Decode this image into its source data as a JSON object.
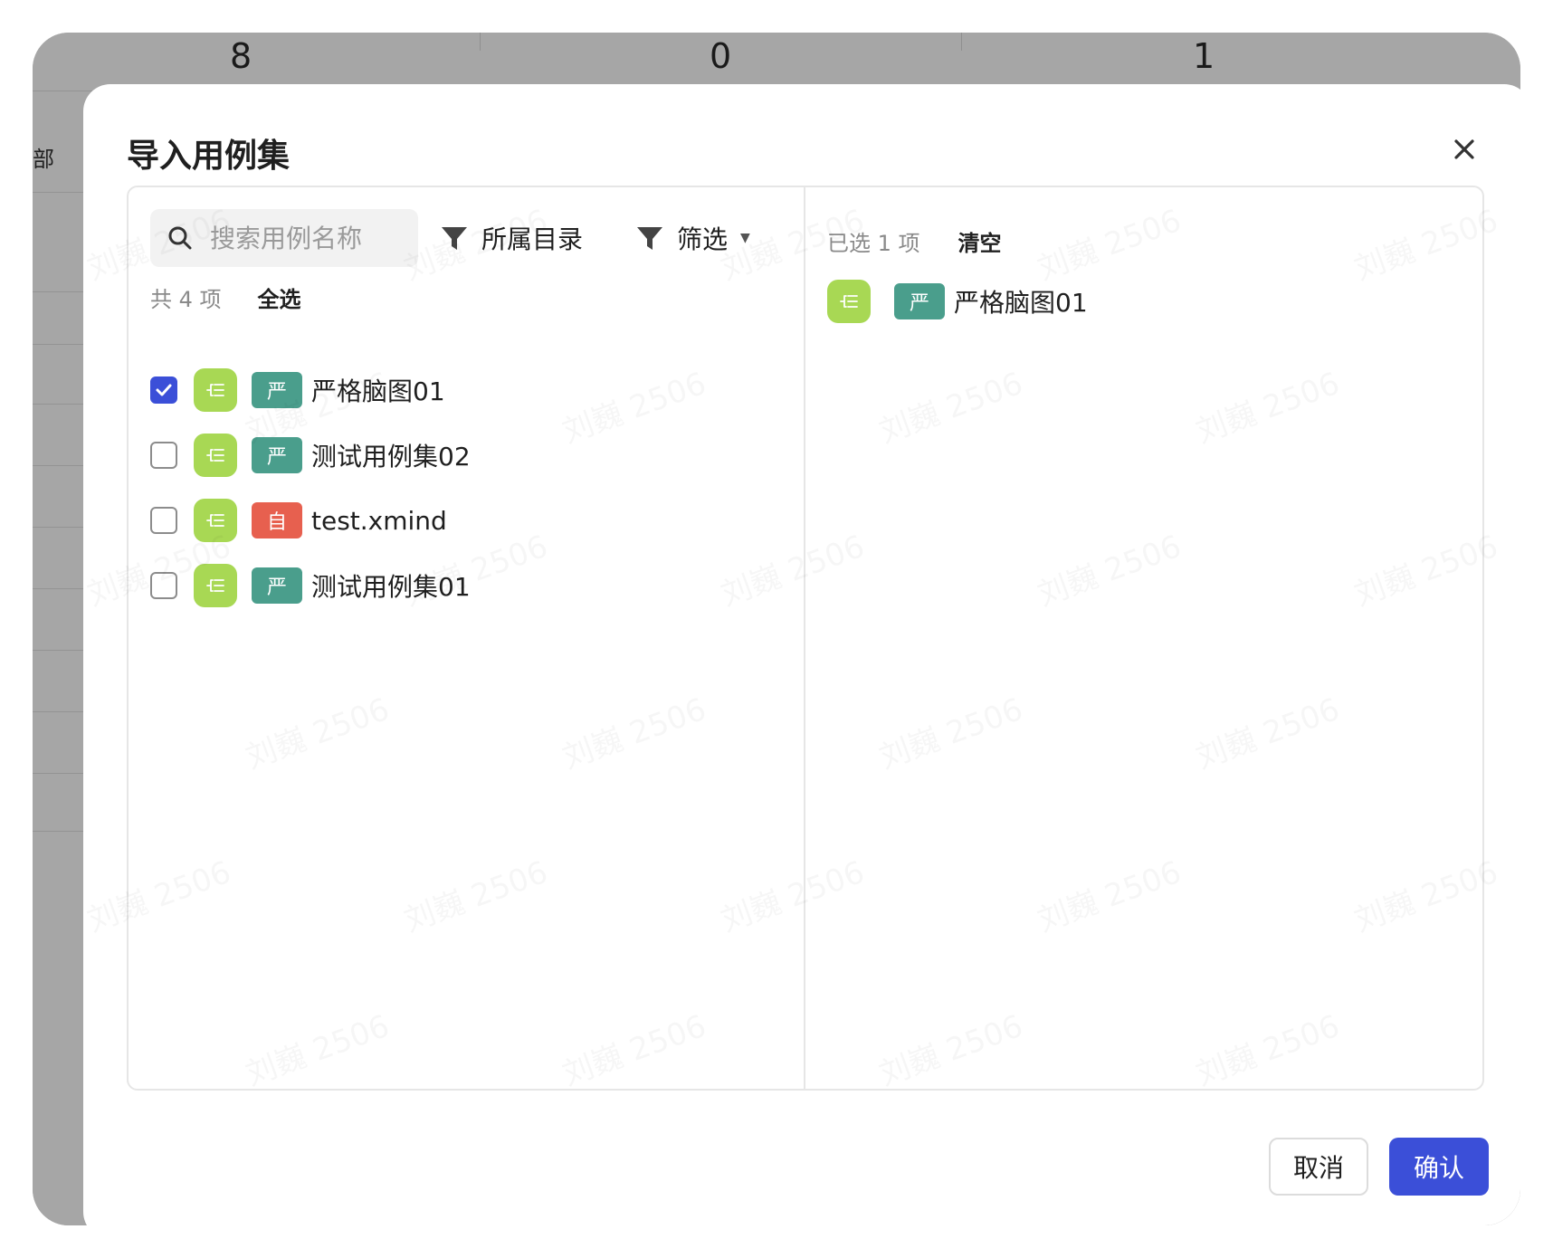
{
  "background": {
    "stats": [
      "8",
      "0",
      "1"
    ],
    "side_glyph": "部"
  },
  "dialog": {
    "title": "导入用例集",
    "search": {
      "placeholder": "搜索用例名称"
    },
    "filters": {
      "directory_label": "所属目录",
      "filter_label": "筛选"
    },
    "left": {
      "count_text": "共 4 项",
      "select_all": "全选",
      "items": [
        {
          "checked": true,
          "tag": "严",
          "tag_color": "#4a9e8c",
          "name": "严格脑图01"
        },
        {
          "checked": false,
          "tag": "严",
          "tag_color": "#4a9e8c",
          "name": "测试用例集02"
        },
        {
          "checked": false,
          "tag": "自",
          "tag_color": "#e7604f",
          "name": "test.xmind"
        },
        {
          "checked": false,
          "tag": "严",
          "tag_color": "#4a9e8c",
          "name": "测试用例集01"
        }
      ]
    },
    "right": {
      "count_text": "已选 1 项",
      "clear": "清空",
      "items": [
        {
          "tag": "严",
          "tag_color": "#4a9e8c",
          "name": "严格脑图01"
        }
      ]
    },
    "buttons": {
      "cancel": "取消",
      "confirm": "确认"
    }
  },
  "colors": {
    "primary": "#3b4fd8",
    "mind_icon": "#a8d854"
  },
  "watermark_text": "刘巍 2506"
}
